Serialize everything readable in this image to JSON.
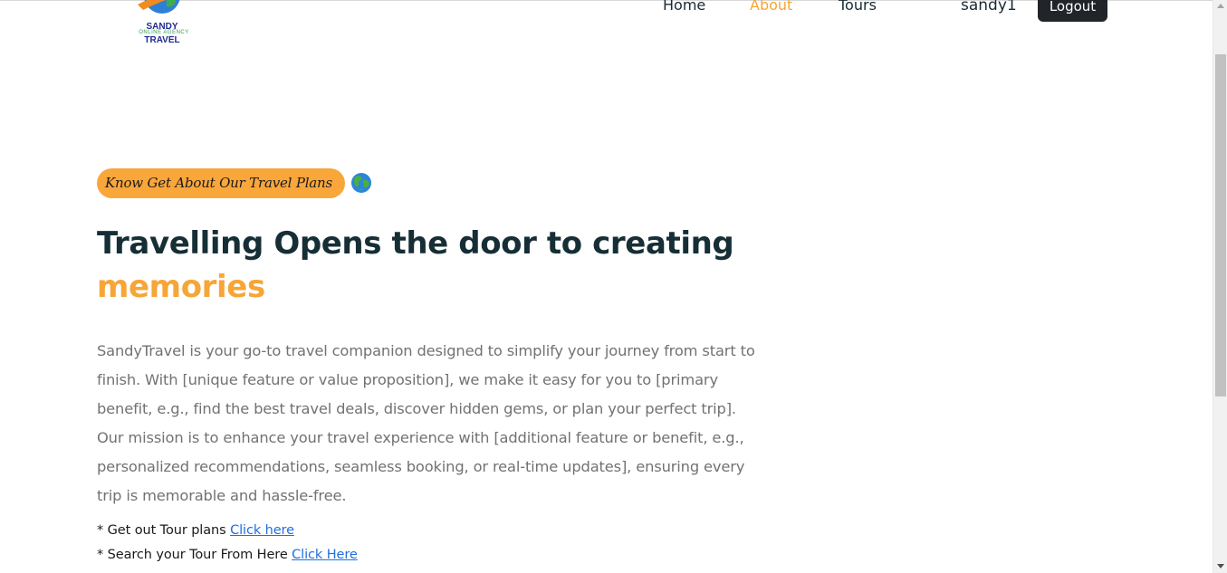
{
  "header": {
    "logo": {
      "title_line1": "SANDY",
      "subtitle": "ONLINE AGENCY",
      "title_line2": "TRAVEL"
    },
    "nav": {
      "home": "Home",
      "about": "About",
      "tours": "Tours"
    },
    "username": "sandy1",
    "logout_label": "Logout"
  },
  "hero": {
    "tagline": "Know Get About Our Travel Plans",
    "tagline_emoji": "globe-icon",
    "headline_main": "Travelling Opens the door to creating",
    "headline_accent": "memories",
    "description": "SandyTravel is your go-to travel companion designed to simplify your journey from start to finish. With [unique feature or value proposition], we make it easy for you to [primary benefit, e.g., find the best travel deals, discover hidden gems, or plan your perfect trip]. Our mission is to enhance your travel experience with [additional feature or benefit, e.g., personalized recommendations, seamless booking, or real-time updates], ensuring every trip is memorable and hassle-free.",
    "links": [
      {
        "prefix": "* Get out Tour plans ",
        "link_text": "Click here"
      },
      {
        "prefix": "* Search your Tour From Here ",
        "link_text": "Click Here"
      }
    ]
  },
  "colors": {
    "accent": "#f7a536",
    "heading": "#162e35",
    "body_text": "#727272",
    "link": "#1f6fe0",
    "button_dark": "#212529"
  }
}
